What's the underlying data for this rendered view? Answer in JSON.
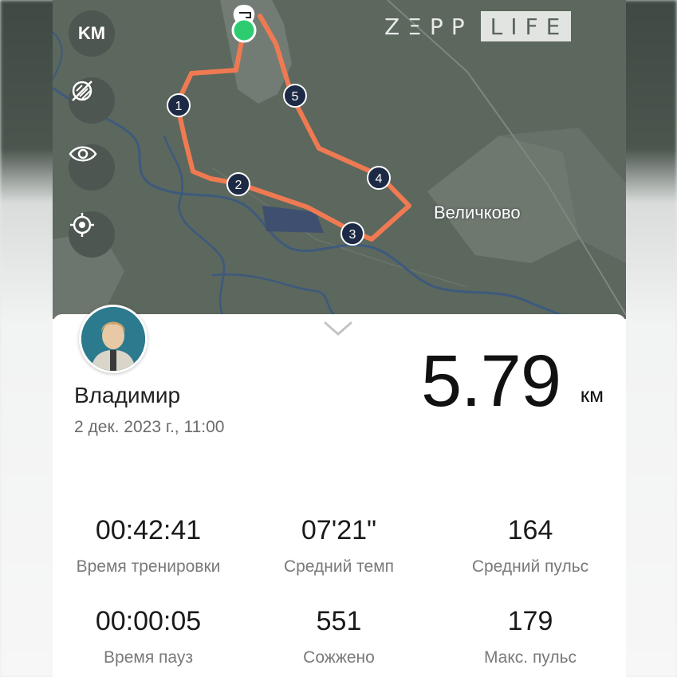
{
  "map": {
    "brand_part1": "ZΞPP",
    "brand_part2": "LIFE",
    "place_label": "Величково",
    "controls": {
      "unit_label": "KM",
      "layers_icon": "satellite-off-icon",
      "visibility_icon": "eye-icon",
      "locate_icon": "crosshair-icon"
    },
    "route_color": "#ef7a52",
    "km_markers": [
      "1",
      "2",
      "3",
      "4",
      "5"
    ],
    "start_marker_color": "#2ecc71"
  },
  "workout": {
    "user_name": "Владимир",
    "date": "2 дек. 2023 г., 11:00",
    "distance": "5.79",
    "distance_unit": "км"
  },
  "stats": [
    {
      "value": "00:42:41",
      "label": "Время тренировки"
    },
    {
      "value": "07'21\"",
      "label": "Средний темп"
    },
    {
      "value": "164",
      "label": "Средний пульс"
    },
    {
      "value": "00:00:05",
      "label": "Время пауз"
    },
    {
      "value": "551",
      "label": "Сожжено"
    },
    {
      "value": "179",
      "label": "Макс. пульс"
    }
  ]
}
